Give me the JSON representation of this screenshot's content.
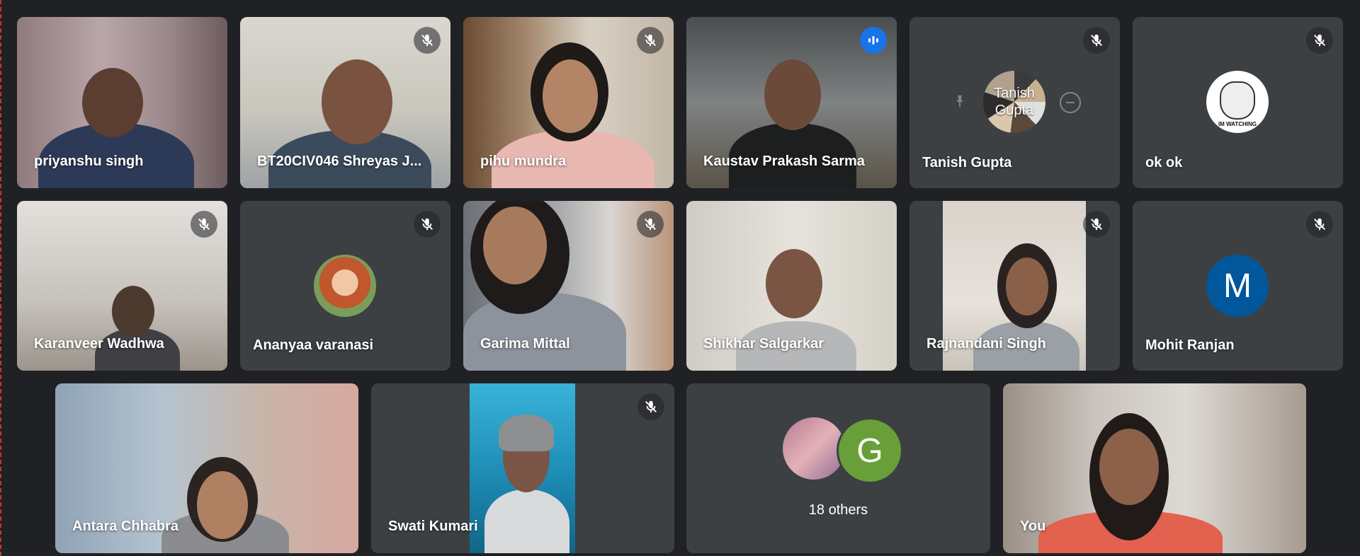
{
  "participants": [
    {
      "name": "priyanshu singh"
    },
    {
      "name": "BT20CIV046 Shreyas J..."
    },
    {
      "name": "pihu mundra"
    },
    {
      "name": "Kaustav Prakash Sarma"
    },
    {
      "name": "Tanish Gupta",
      "avatar_text": "Tanish Gupta"
    },
    {
      "name": "ok ok",
      "avatar_text": "IM WATCHING"
    },
    {
      "name": "Karanveer Wadhwa"
    },
    {
      "name": "Ananyaa varanasi"
    },
    {
      "name": "Garima Mittal"
    },
    {
      "name": "Shikhar Salgarkar"
    },
    {
      "name": "Rajnandani Singh"
    },
    {
      "name": "Mohit Ranjan",
      "avatar_letter": "M"
    },
    {
      "name": "Antara Chhabra"
    },
    {
      "name": "Swati Kumari"
    },
    {
      "name": "You"
    }
  ],
  "others": {
    "label": "18 others",
    "avatar_letter": "G"
  },
  "icons": {
    "muted": "mic-off-icon",
    "speaking": "audio-level-icon",
    "pin": "pin-icon",
    "remove": "remove-icon"
  },
  "colors": {
    "background": "#202124",
    "tile": "#3c4043",
    "active_border": "#8ab4f8",
    "speaking": "#1a73e8",
    "avatar_m": "#01579b",
    "avatar_g": "#689f38"
  }
}
